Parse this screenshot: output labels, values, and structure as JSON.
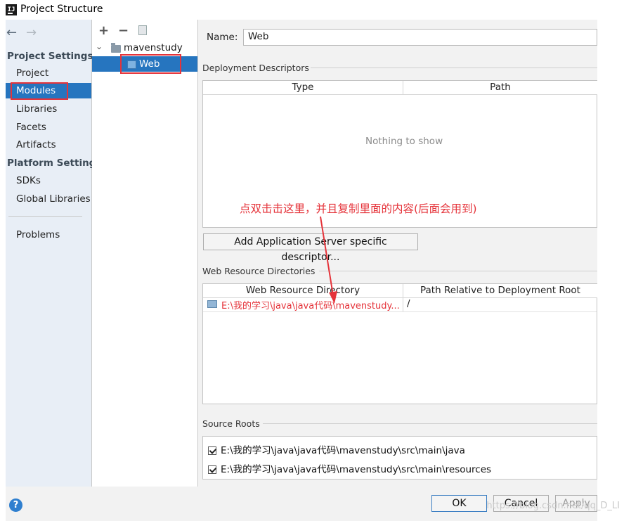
{
  "window": {
    "title": "Project Structure",
    "app_icon_text": "IJ"
  },
  "sidebar": {
    "back_icon": "left-arrow-icon",
    "forward_icon": "right-arrow-icon",
    "back_glyph": "←",
    "forward_glyph": "→",
    "project_settings_header": "Project Settings",
    "project_items": [
      "Project",
      "Modules",
      "Libraries",
      "Facets",
      "Artifacts"
    ],
    "platform_settings_header": "Platform Settings",
    "platform_items": [
      "SDKs",
      "Global Libraries"
    ],
    "other_items": [
      "Problems"
    ],
    "selected": "Modules"
  },
  "tree": {
    "add_glyph": "+",
    "remove_glyph": "−",
    "copy_icon": "copy-icon",
    "root": "mavenstudy",
    "child": "Web",
    "expand_glyph": "⌄"
  },
  "facet": {
    "name_label": "Name:",
    "name_value": "Web",
    "deployment_descriptors_title": "Deployment Descriptors",
    "dd_columns": [
      "Type",
      "Path"
    ],
    "dd_empty_text": "Nothing to show",
    "add_server_button": "Add Application Server specific descriptor...",
    "web_resource_title": "Web Resource Directories",
    "wr_columns": [
      "Web Resource Directory",
      "Path Relative to Deployment Root"
    ],
    "wr_rows": [
      {
        "directory": "E:\\我的学习\\java\\java代码\\mavenstudy...",
        "path": "/"
      }
    ],
    "source_roots_title": "Source Roots",
    "source_roots": [
      {
        "checked": true,
        "path": "E:\\我的学习\\java\\java代码\\mavenstudy\\src\\main\\java"
      },
      {
        "checked": true,
        "path": "E:\\我的学习\\java\\java代码\\mavenstudy\\src\\main\\resources"
      }
    ]
  },
  "annotation": {
    "text": "点双击击这里，并且复制里面的内容(后面会用到)",
    "color": "#e5333a"
  },
  "footer": {
    "help_glyph": "?",
    "ok_label": "OK",
    "cancel_label": "Cancel",
    "apply_label": "Apply",
    "watermark": "https://blog.csdn.net/qq_D_LI"
  },
  "colors": {
    "selection": "#2675bf",
    "highlight_box": "#e5333a",
    "sidebar_bg": "#e8eef6"
  }
}
